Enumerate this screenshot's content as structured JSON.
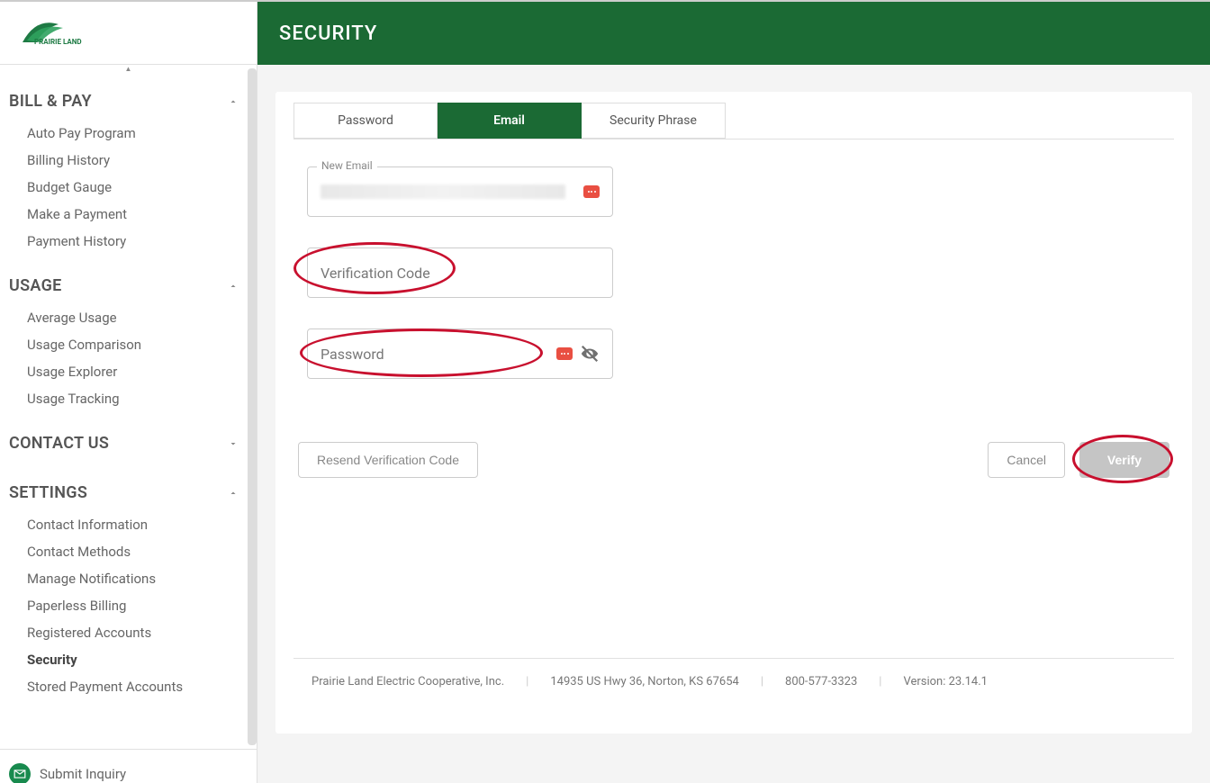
{
  "logo_text": "PRAIRIE LAND",
  "sidebar": {
    "sections": [
      {
        "title": "BILL & PAY",
        "expanded": true,
        "items": [
          "Auto Pay Program",
          "Billing History",
          "Budget Gauge",
          "Make a Payment",
          "Payment History"
        ]
      },
      {
        "title": "USAGE",
        "expanded": true,
        "items": [
          "Average Usage",
          "Usage Comparison",
          "Usage Explorer",
          "Usage Tracking"
        ]
      },
      {
        "title": "CONTACT US",
        "expanded": false,
        "items": []
      },
      {
        "title": "SETTINGS",
        "expanded": true,
        "items": [
          "Contact Information",
          "Contact Methods",
          "Manage Notifications",
          "Paperless Billing",
          "Registered Accounts",
          "Security",
          "Stored Payment Accounts"
        ],
        "active": "Security"
      }
    ],
    "bottom_action": "Submit Inquiry"
  },
  "header": {
    "title": "SECURITY"
  },
  "tabs": {
    "items": [
      "Password",
      "Email",
      "Security Phrase"
    ],
    "active": "Email"
  },
  "form": {
    "new_email_label": "New Email",
    "verification_code_label": "Verification Code",
    "password_label": "Password"
  },
  "buttons": {
    "resend": "Resend Verification Code",
    "cancel": "Cancel",
    "verify": "Verify"
  },
  "footer": {
    "company": "Prairie Land Electric Cooperative, Inc.",
    "address": "14935 US Hwy 36, Norton, KS 67654",
    "phone": "800-577-3323",
    "version": "Version: 23.14.1"
  }
}
